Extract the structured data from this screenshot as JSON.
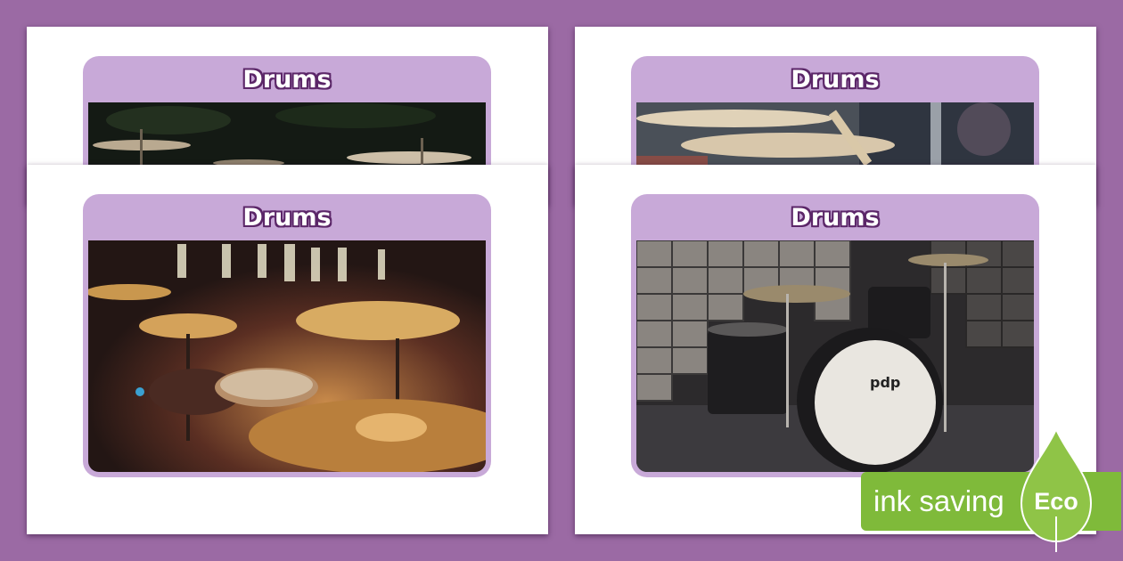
{
  "cards": [
    {
      "title": "Drums",
      "photo": "cymbals-dark-stage"
    },
    {
      "title": "Drums",
      "photo": "cymbals-drumsticks-blur"
    },
    {
      "title": "Drums",
      "photo": "drum-kit-warm-lights"
    },
    {
      "title": "Drums",
      "photo": "black-drum-kit-lockers"
    }
  ],
  "badge": {
    "label": "ink saving",
    "eco": "Eco"
  },
  "colors": {
    "background": "#9b6aa4",
    "frame": "#c8a9d8",
    "title_outline": "#5b2668",
    "eco_green": "#7fba3a"
  },
  "icons": {
    "leaf": "leaf-icon"
  }
}
